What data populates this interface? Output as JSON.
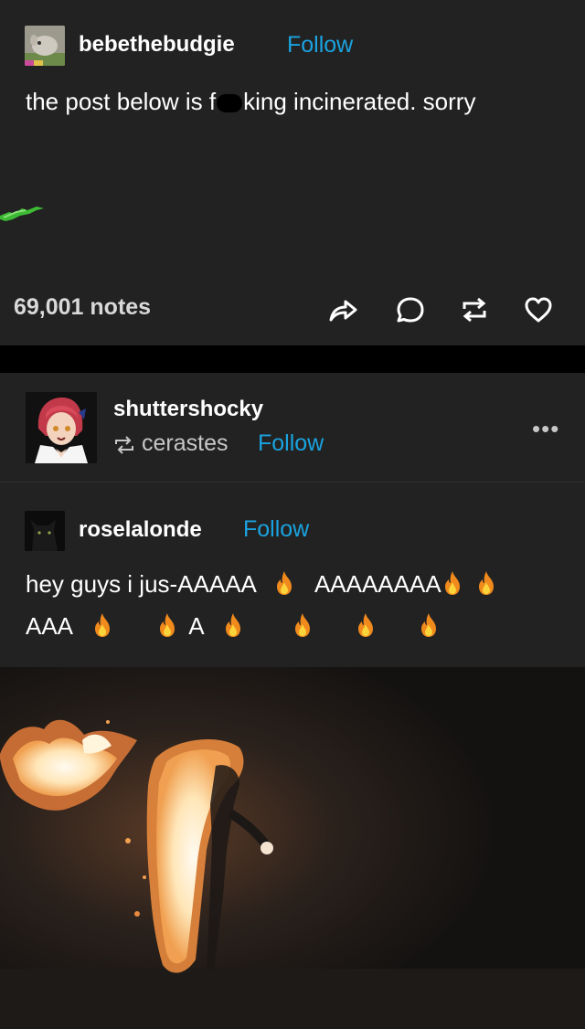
{
  "colors": {
    "background": "#222222",
    "divider": "#000000",
    "follow": "#1aa3e0",
    "text": "#ffffff",
    "muted": "#c7c7c7"
  },
  "post1": {
    "username": "bebethebudgie",
    "follow_label": "Follow",
    "text_before_censor": "the post below is f",
    "text_after_censor": "king incinerated. sorry",
    "notes": "69,001 notes",
    "action_icons": [
      "share-icon",
      "reply-icon",
      "reblog-icon",
      "like-icon"
    ]
  },
  "post2": {
    "rebloggger": "shuttershocky",
    "reblogged_from": "cerastes",
    "follow_label": "Follow",
    "more_label": "•••",
    "original_author": "roselalonde",
    "original_follow_label": "Follow",
    "line1_a": "hey guys i jus-AAAAA",
    "line1_b": "AAAAAAAA",
    "line2_a": "AAA",
    "line2_b": "A",
    "fire_icon": "fire-emoji-icon"
  }
}
